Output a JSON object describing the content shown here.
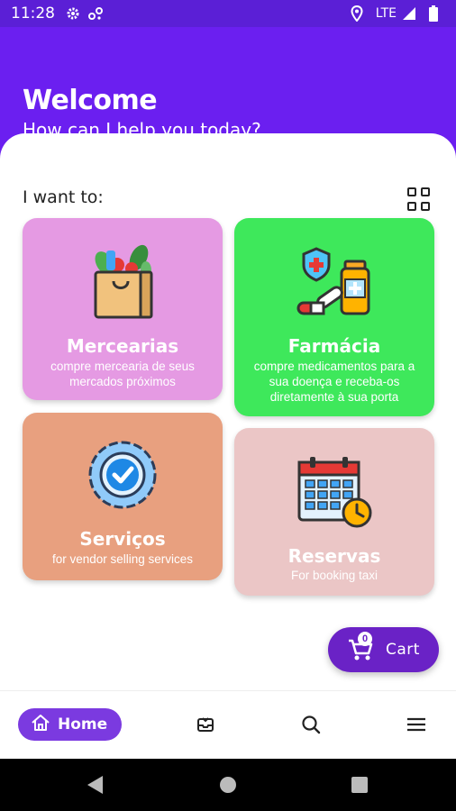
{
  "status_bar": {
    "time": "11:28",
    "network": "LTE",
    "icons": [
      "settings-icon",
      "data-sync-icon",
      "location-icon",
      "signal-icon",
      "battery-icon"
    ]
  },
  "header": {
    "title": "Welcome",
    "subtitle": "How can I help you today?"
  },
  "main": {
    "section_label": "I want to:",
    "cards": [
      {
        "title": "Mercearias",
        "description": "compre mercearia de seus mercados próximos",
        "color": "#e59ae3",
        "icon": "grocery-bag-icon"
      },
      {
        "title": "Farmácia",
        "description": "compre medicamentos para a sua doença e receba-os diretamente à sua porta",
        "color": "#3ee85b",
        "icon": "medicine-icon"
      },
      {
        "title": "Serviços",
        "description": "for vendor selling services",
        "color": "#e8a07f",
        "icon": "service-badge-icon"
      },
      {
        "title": "Reservas",
        "description": "For booking taxi",
        "color": "#ebc6c6",
        "icon": "calendar-clock-icon"
      }
    ]
  },
  "cart": {
    "label": "Cart",
    "count": "0"
  },
  "bottom_nav": {
    "items": [
      {
        "label": "Home",
        "icon": "home-icon",
        "active": true
      },
      {
        "label": "",
        "icon": "inbox-icon"
      },
      {
        "label": "",
        "icon": "search-icon"
      },
      {
        "label": "",
        "icon": "menu-icon"
      }
    ]
  },
  "colors": {
    "primary": "#6b1ff0",
    "status_bar": "#5b1fd6",
    "accent": "#6a22c6"
  }
}
